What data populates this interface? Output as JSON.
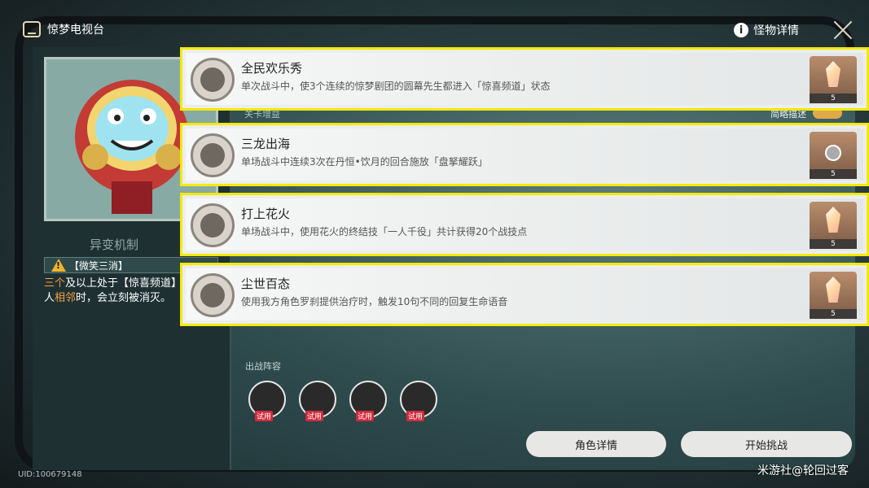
{
  "header": {
    "title": "惊梦电视台",
    "monster_info": "怪物详情"
  },
  "left_panel": {
    "mechanic_title": "异变机制",
    "mechanic_name": "【微笑三消】",
    "mechanic_text_parts": [
      "三个",
      "及以上处于【惊喜频道】",
      "人",
      "相邻",
      "时，会立刻被消灭。"
    ]
  },
  "underlay": {
    "left_partial": "关卡增益",
    "right_partial": "简略描述"
  },
  "achievements": [
    {
      "title": "全民欢乐秀",
      "desc": "单次战斗中，使3个连续的惊梦剧团的圆幕先生都进入「惊喜频道」状态",
      "reward": "5"
    },
    {
      "title": "三龙出海",
      "desc": "单场战斗中连续3次在丹恒•饮月的回合施放「盘拏耀跃」",
      "reward": "5"
    },
    {
      "title": "打上花火",
      "desc": "单场战斗中，使用花火的终结技「一人千役」共计获得20个战技点",
      "reward": "5"
    },
    {
      "title": "尘世百态",
      "desc": "使用我方角色罗刹提供治疗时，触发10句不同的回复生命语音",
      "reward": "5"
    }
  ],
  "team": {
    "label": "出战阵容",
    "trial_tag": "试用"
  },
  "buttons": {
    "character_details": "角色详情",
    "start_challenge": "开始挑战"
  },
  "footer": {
    "uid": "UID:100679148",
    "watermark": "米游社@轮回过客"
  },
  "colors": {
    "highlight": "#f4e900",
    "accent_orange": "#f7a23b"
  }
}
